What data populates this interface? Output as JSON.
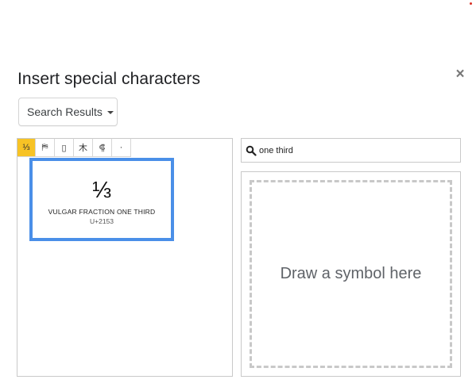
{
  "dialog": {
    "title": "Insert special characters",
    "close_glyph": "×"
  },
  "category_dropdown": {
    "selected": "Search Results"
  },
  "results": {
    "cells": [
      "⅓",
      "⛿",
      "▯",
      "⽊",
      "⸿",
      "·"
    ],
    "selected_index": 0
  },
  "preview": {
    "glyph": "⅓",
    "name": "VULGAR FRACTION ONE THIRD",
    "code": "U+2153"
  },
  "search": {
    "value": "one third"
  },
  "draw": {
    "prompt": "Draw a symbol here"
  },
  "colors": {
    "selected_cell": "#f7c325",
    "preview_border": "#4a8fe8",
    "indicator_dot": "#d93025"
  }
}
